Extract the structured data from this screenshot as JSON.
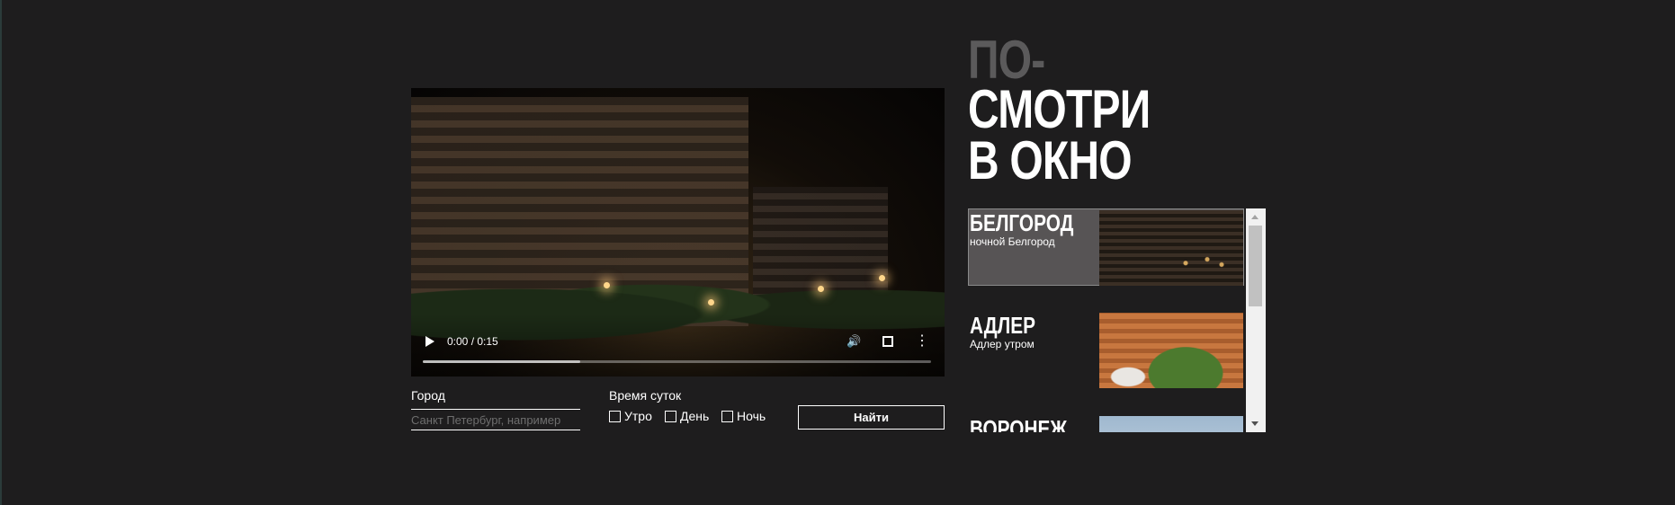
{
  "page": {
    "background": "#1e1d1e",
    "accent_gray": "#5b5a5b"
  },
  "video": {
    "time": "0:00 / 0:15",
    "progress_fraction": 0.31,
    "icons": [
      "play-icon",
      "volume-icon",
      "fullscreen-icon",
      "more-options-icon"
    ]
  },
  "form": {
    "city_label": "Город",
    "city_placeholder": "Санкт Петербург, например",
    "time_label": "Время суток",
    "options": [
      "Утро",
      "День",
      "Ночь"
    ],
    "submit_label": "Найти"
  },
  "title": {
    "line1": "ПО-",
    "line2": "СМОТРИ",
    "line3": "В ОКНО"
  },
  "list": {
    "items": [
      {
        "city": "БЕЛГОРОД",
        "desc": "ночной Белгород",
        "selected": true
      },
      {
        "city": "АДЛЕР",
        "desc": "Адлер утром",
        "selected": false
      },
      {
        "city": "ВОРОНЕЖ",
        "desc": "",
        "selected": false
      }
    ]
  }
}
